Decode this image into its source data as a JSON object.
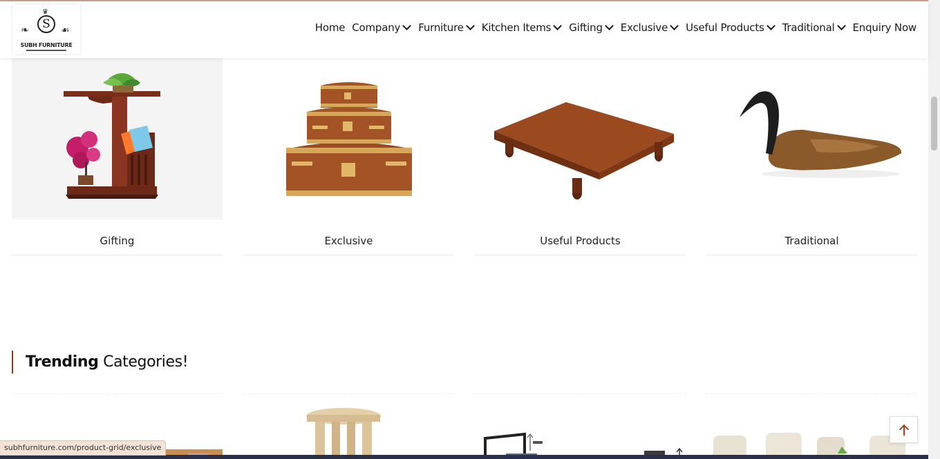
{
  "brand": {
    "name": "SUBH FURNITURE",
    "initial": "S"
  },
  "nav": {
    "items": [
      {
        "label": "Home",
        "dropdown": false
      },
      {
        "label": "Company",
        "dropdown": true
      },
      {
        "label": "Furniture",
        "dropdown": true
      },
      {
        "label": "Kitchen Items",
        "dropdown": true
      },
      {
        "label": "Gifting",
        "dropdown": true
      },
      {
        "label": "Exclusive",
        "dropdown": true
      },
      {
        "label": "Useful Products",
        "dropdown": true
      },
      {
        "label": "Traditional",
        "dropdown": true
      },
      {
        "label": "Enquiry Now",
        "dropdown": false
      }
    ]
  },
  "categories": [
    {
      "label": "Gifting",
      "image": "side-table-with-plant-and-magazine-rack"
    },
    {
      "label": "Exclusive",
      "image": "stacked-wooden-chests-brass"
    },
    {
      "label": "Useful Products",
      "image": "low-wooden-chowki-table"
    },
    {
      "label": "Traditional",
      "image": "carved-wooden-duck"
    }
  ],
  "trending": {
    "title_bold": "Trending",
    "title_rest": " Categories!"
  },
  "status_bar": {
    "url": "subhfurniture.com/product-grid/exclusive"
  },
  "colors": {
    "accent": "#8a3b1f",
    "arrow": "#a0401f"
  }
}
